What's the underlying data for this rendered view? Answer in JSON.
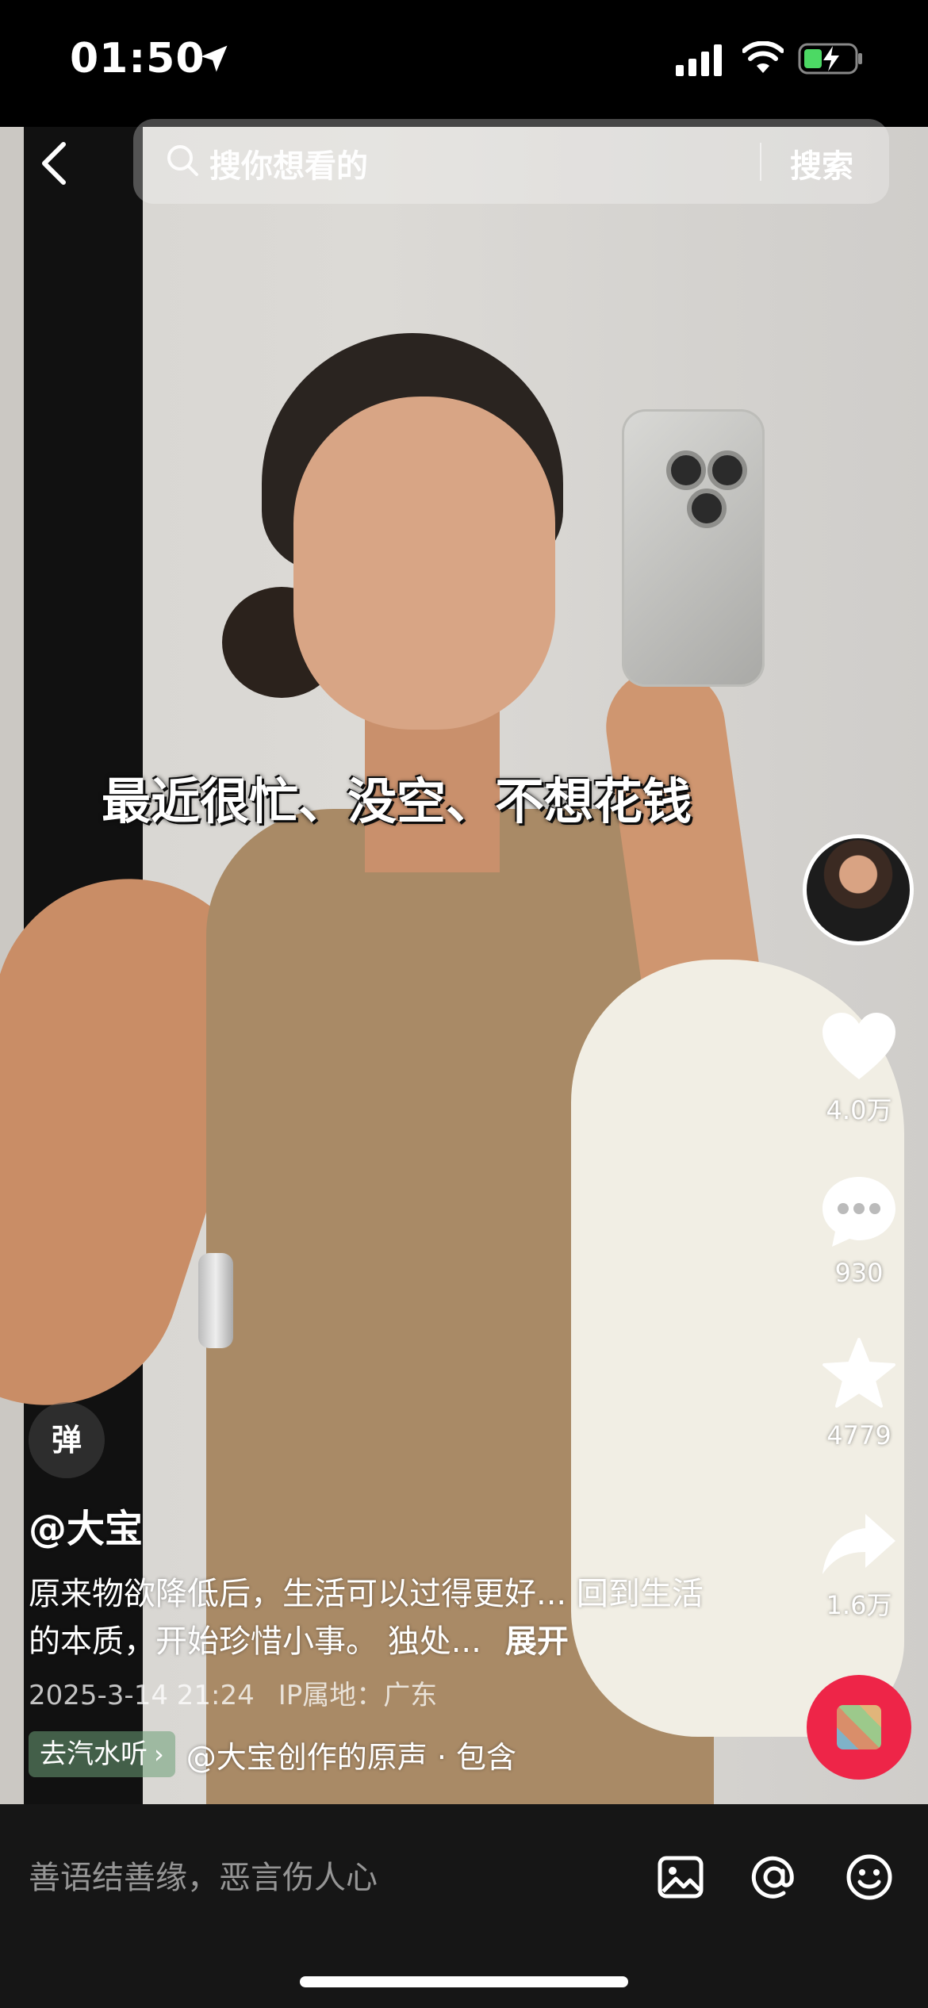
{
  "status_bar": {
    "time": "01:50",
    "icons": [
      "location-arrow-icon",
      "cellular-signal-icon",
      "wifi-icon",
      "battery-charging-icon"
    ]
  },
  "top_nav": {
    "back_icon": "chevron-left-icon",
    "search_placeholder": "搜你想看的",
    "search_button": "搜索"
  },
  "video": {
    "subtitle": "最近很忙、没空、不想花钱"
  },
  "right_rail": {
    "like_count": "4.0万",
    "comment_count": "930",
    "favorite_count": "4779",
    "share_count": "1.6万"
  },
  "danmaku_label": "弹",
  "post": {
    "author": "@大宝",
    "description": "原来物欲降低后，生活可以过得更好... 回到生活的本质，开始珍惜小事。 独处...",
    "expand_label": "展开",
    "date": "2025-3-14 21:24",
    "ip_location": "IP属地：广东",
    "music_chip": "去汽水听",
    "music_text": "@大宝创作的原声 · 包含"
  },
  "bottom_bar": {
    "comment_placeholder": "善语结善缘，恶言伤人心",
    "icons": [
      "image-icon",
      "at-mention-icon",
      "emoji-icon"
    ]
  },
  "colors": {
    "accent_red": "#ee2548",
    "bottom_bar_bg": "#161616"
  }
}
